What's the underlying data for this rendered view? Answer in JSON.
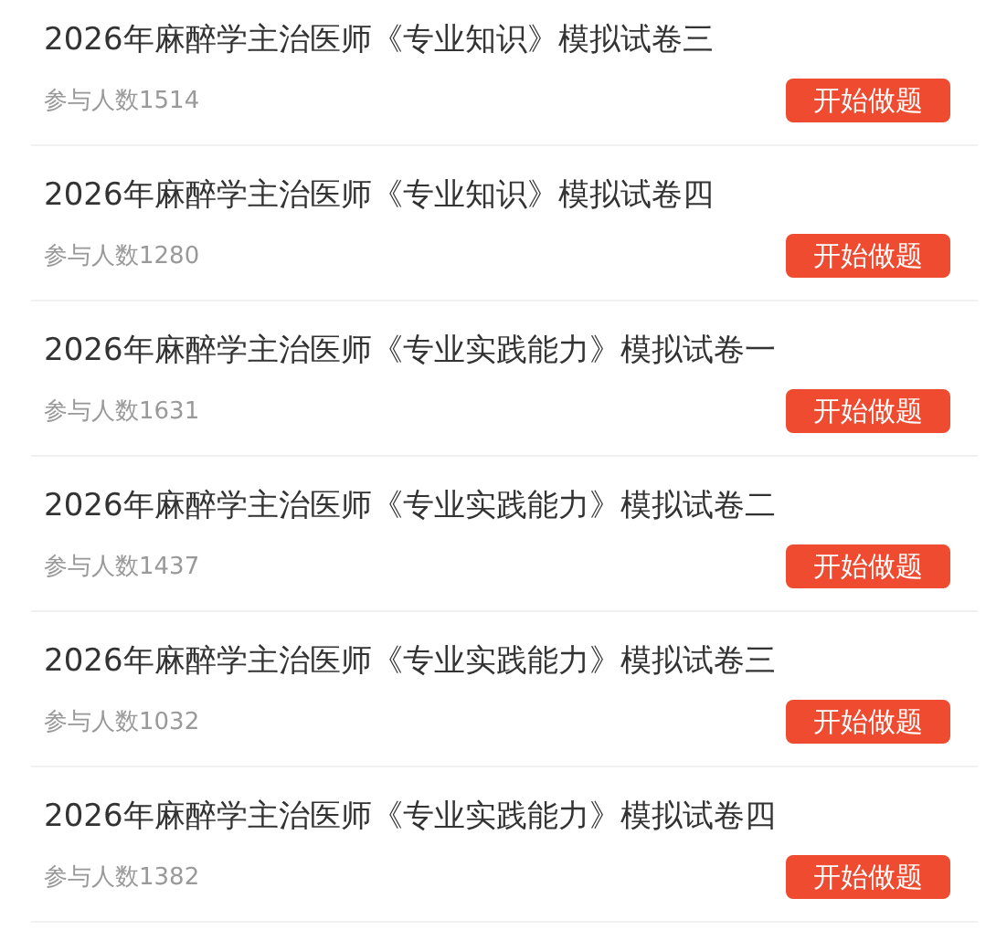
{
  "exams": [
    {
      "title": "2026年麻醉学主治医师《专业知识》模拟试卷三",
      "participants": "参与人数1514",
      "button": "开始做题"
    },
    {
      "title": "2026年麻醉学主治医师《专业知识》模拟试卷四",
      "participants": "参与人数1280",
      "button": "开始做题"
    },
    {
      "title": "2026年麻醉学主治医师《专业实践能力》模拟试卷一",
      "participants": "参与人数1631",
      "button": "开始做题"
    },
    {
      "title": "2026年麻醉学主治医师《专业实践能力》模拟试卷二",
      "participants": "参与人数1437",
      "button": "开始做题"
    },
    {
      "title": "2026年麻醉学主治医师《专业实践能力》模拟试卷三",
      "participants": "参与人数1032",
      "button": "开始做题"
    },
    {
      "title": "2026年麻醉学主治医师《专业实践能力》模拟试卷四",
      "participants": "参与人数1382",
      "button": "开始做题"
    }
  ]
}
